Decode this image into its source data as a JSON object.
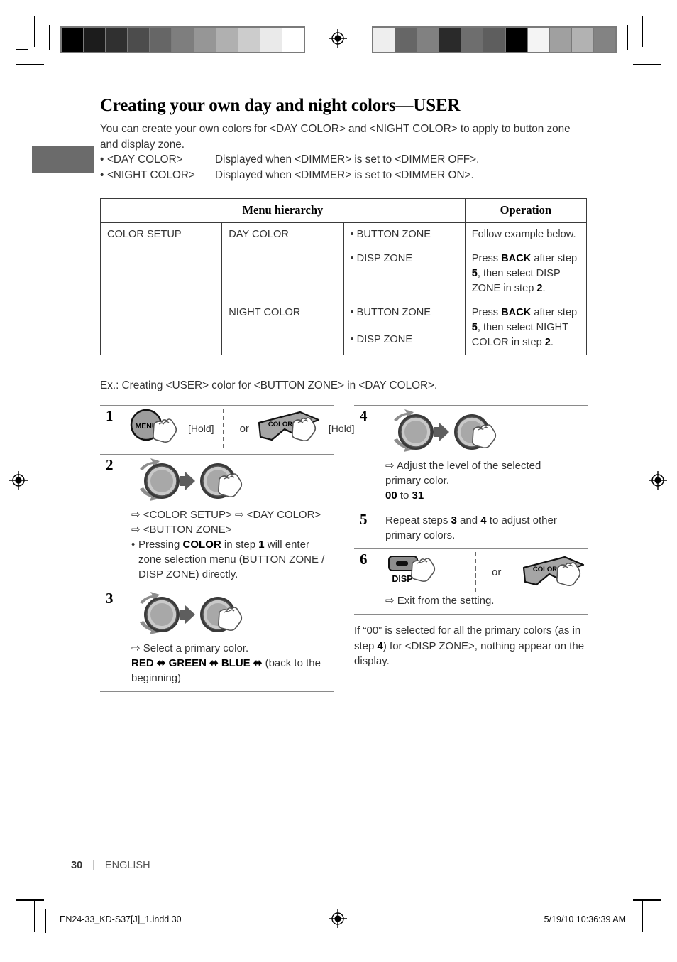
{
  "page": {
    "title": "Creating your own day and night colors—USER",
    "intro_line1": "You can create your own colors for <DAY COLOR> and <NIGHT COLOR> to apply to button zone",
    "intro_line2": "and display zone.",
    "bullets": [
      {
        "bullet": "•",
        "term": "<DAY COLOR>",
        "desc": "Displayed when <DIMMER> is set to <DIMMER OFF>."
      },
      {
        "bullet": "•",
        "term": "<NIGHT COLOR>",
        "desc": "Displayed when <DIMMER> is set to <DIMMER ON>."
      }
    ],
    "example_caption": "Ex.: Creating <USER> color for <BUTTON ZONE> in <DAY COLOR>."
  },
  "table": {
    "headers": {
      "hierarchy": "Menu hierarchy",
      "operation": "Operation"
    },
    "setup_label": "COLOR SETUP",
    "rows": [
      {
        "group": "DAY COLOR",
        "zone": "• BUTTON ZONE",
        "operation": "Follow example below.",
        "operation_parts": [
          {
            "t": "Follow example below.",
            "b": false
          }
        ]
      },
      {
        "group": "DAY COLOR",
        "zone": "• DISP ZONE",
        "operation": "Press BACK after step 5, then select DISP ZONE in step 2.",
        "operation_parts": [
          {
            "t": "Press ",
            "b": false
          },
          {
            "t": "BACK",
            "b": true
          },
          {
            "t": " after step ",
            "b": false
          },
          {
            "t": "5",
            "b": true
          },
          {
            "t": ", then select DISP ZONE in step ",
            "b": false
          },
          {
            "t": "2",
            "b": true
          },
          {
            "t": ".",
            "b": false
          }
        ]
      },
      {
        "group": "NIGHT COLOR",
        "zone": "• BUTTON ZONE",
        "operation": "Press BACK after step 5, then select NIGHT COLOR in step 2.",
        "operation_parts": [
          {
            "t": "Press ",
            "b": false
          },
          {
            "t": "BACK",
            "b": true
          },
          {
            "t": " after step ",
            "b": false
          },
          {
            "t": "5",
            "b": true
          },
          {
            "t": ", then select NIGHT COLOR in step ",
            "b": false
          },
          {
            "t": "2",
            "b": true
          },
          {
            "t": ".",
            "b": false
          }
        ]
      },
      {
        "group": "NIGHT COLOR",
        "zone": "• DISP ZONE",
        "operation": "",
        "operation_parts": []
      }
    ]
  },
  "steps": {
    "step1": {
      "num": "1",
      "button_menu_label": "MENU",
      "hold_label_1": "[Hold]",
      "or_label": "or",
      "button_color_label": "COLOR",
      "hold_label_2": "[Hold]"
    },
    "step2": {
      "num": "2",
      "result_line1": "⇨ <COLOR SETUP> ⇨ <DAY COLOR>",
      "result_line2": "⇨ <BUTTON ZONE>",
      "note_bullet": "•",
      "note_parts": [
        {
          "t": "Pressing ",
          "b": false
        },
        {
          "t": "COLOR",
          "b": true
        },
        {
          "t": " in step ",
          "b": false
        },
        {
          "t": "1",
          "b": true
        },
        {
          "t": " will enter zone selection menu (BUTTON ZONE / DISP ZONE) directly.",
          "b": false
        }
      ]
    },
    "step3": {
      "num": "3",
      "result_line": "⇨ Select a primary color.",
      "sequence_parts": [
        {
          "t": "RED",
          "b": true
        },
        {
          "t": " ⬌ ",
          "b": true
        },
        {
          "t": "GREEN",
          "b": true
        },
        {
          "t": " ⬌ ",
          "b": true
        },
        {
          "t": "BLUE",
          "b": true
        },
        {
          "t": " ⬌ ",
          "b": true
        },
        {
          "t": " (back to the beginning)",
          "b": false
        }
      ]
    },
    "step4": {
      "num": "4",
      "result_line1": "⇨ Adjust the level of the selected",
      "result_line2": "primary color.",
      "range_parts": [
        {
          "t": "00",
          "b": true
        },
        {
          "t": " to ",
          "b": false
        },
        {
          "t": "31",
          "b": true
        }
      ]
    },
    "step5": {
      "num": "5",
      "text_parts": [
        {
          "t": "Repeat steps ",
          "b": false
        },
        {
          "t": "3",
          "b": true
        },
        {
          "t": " and ",
          "b": false
        },
        {
          "t": "4",
          "b": true
        },
        {
          "t": " to adjust other primary colors.",
          "b": false
        }
      ]
    },
    "step6": {
      "num": "6",
      "button_disp_label": "DISP",
      "or_label": "or",
      "button_color_label": "COLOR",
      "result_line": "⇨ Exit from the setting."
    },
    "tail_note_parts": [
      {
        "t": "If “00” is selected for all the primary colors (as in step ",
        "b": false
      },
      {
        "t": "4",
        "b": true
      },
      {
        "t": ") for <DISP ZONE>, nothing appear on the display.",
        "b": false
      }
    ]
  },
  "footer": {
    "page_number": "30",
    "separator": "|",
    "language": "ENGLISH",
    "file_name": "EN24-33_KD-S37[J]_1.indd   30",
    "timestamp": "5/19/10   10:36:39 AM"
  },
  "calibration": {
    "left_swatches": [
      "#000000",
      "#1c1c1c",
      "#303030",
      "#4c4c4c",
      "#666666",
      "#7e7e7e",
      "#969696",
      "#b0b0b0",
      "#cccccc",
      "#eaeaea",
      "#ffffff"
    ],
    "right_swatches": [
      "#eeeeee",
      "#666666",
      "#818181",
      "#2a2a2a",
      "#6e6e6e",
      "#5e5e5e",
      "#000000",
      "#f4f4f4",
      "#a0a0a0",
      "#b2b2b2",
      "#838383"
    ]
  }
}
